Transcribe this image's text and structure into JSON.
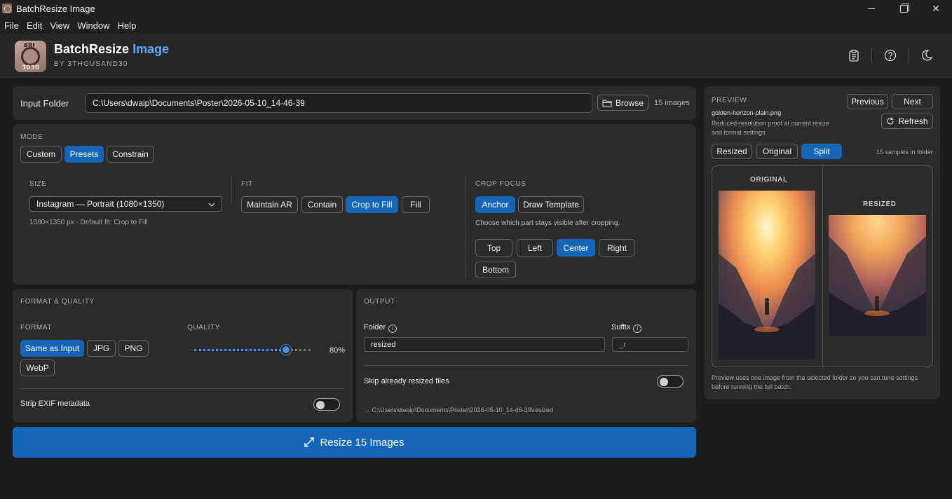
{
  "window": {
    "title": "BatchResize Image"
  },
  "menu": [
    "File",
    "Edit",
    "View",
    "Window",
    "Help"
  ],
  "header": {
    "logo_text_top": "BRI",
    "logo_text_bottom": "3030",
    "brand_main": "BatchResize",
    "brand_accent": "Image",
    "byline": "BY 3THOUSAND30",
    "icons": [
      "clipboard-icon",
      "help-icon",
      "moon-icon"
    ],
    "accent_color": "#5aa9ff"
  },
  "input": {
    "label": "Input Folder",
    "path": "C:\\Users\\dwaip\\Documents\\Poster\\2026-05-10_14-46-39",
    "browse_label": "Browse",
    "count": "15 images"
  },
  "mode": {
    "label": "MODE",
    "options": [
      "Custom",
      "Presets",
      "Constrain"
    ],
    "selected": "Presets"
  },
  "size": {
    "label": "SIZE",
    "selected": "Instagram — Portrait (1080×1350)",
    "hint": "1080×1350 px · Default fit: Crop to Fill"
  },
  "fit": {
    "label": "FIT",
    "options": [
      "Maintain AR",
      "Contain",
      "Crop to Fill",
      "Fill"
    ],
    "selected": "Crop to Fill"
  },
  "crop_focus": {
    "label": "CROP FOCUS",
    "tabs": [
      "Anchor",
      "Draw Template"
    ],
    "selected_tab": "Anchor",
    "hint": "Choose which part stays visible after cropping.",
    "anchors": [
      "Top",
      "Left",
      "Center",
      "Right",
      "Bottom"
    ],
    "selected_anchor": "Center"
  },
  "format_quality": {
    "title": "FORMAT & QUALITY",
    "format_label": "FORMAT",
    "formats": [
      "Same as Input",
      "JPG",
      "PNG",
      "WebP"
    ],
    "selected_format": "Same as Input",
    "quality_label": "QUALITY",
    "quality": 80,
    "quality_text": "80%",
    "strip_exif_label": "Strip EXIF metadata",
    "strip_exif": false
  },
  "output": {
    "title": "OUTPUT",
    "folder_label": "Folder",
    "folder_value": "resized",
    "suffix_label": "Suffix",
    "suffix_placeholder": "_r",
    "skip_label": "Skip already resized files",
    "skip": false,
    "dest_path": "→ C:\\Users\\dwaip\\Documents\\Poster\\2026-05-10_14-46-39\\resized"
  },
  "action": {
    "label": "Resize 15 Images"
  },
  "preview": {
    "title": "PREVIEW",
    "filename": "golden-horizon-plain.png",
    "description": "Reduced-resolution proof at current resize and format settings.",
    "prev_label": "Previous",
    "next_label": "Next",
    "refresh_label": "Refresh",
    "views": [
      "Resized",
      "Original",
      "Split"
    ],
    "selected_view": "Split",
    "samples": "15 samples in folder",
    "original_label": "ORIGINAL",
    "resized_label": "RESIZED",
    "footer": "Preview uses one image from the selected folder so you can tune settings before running the full batch."
  }
}
